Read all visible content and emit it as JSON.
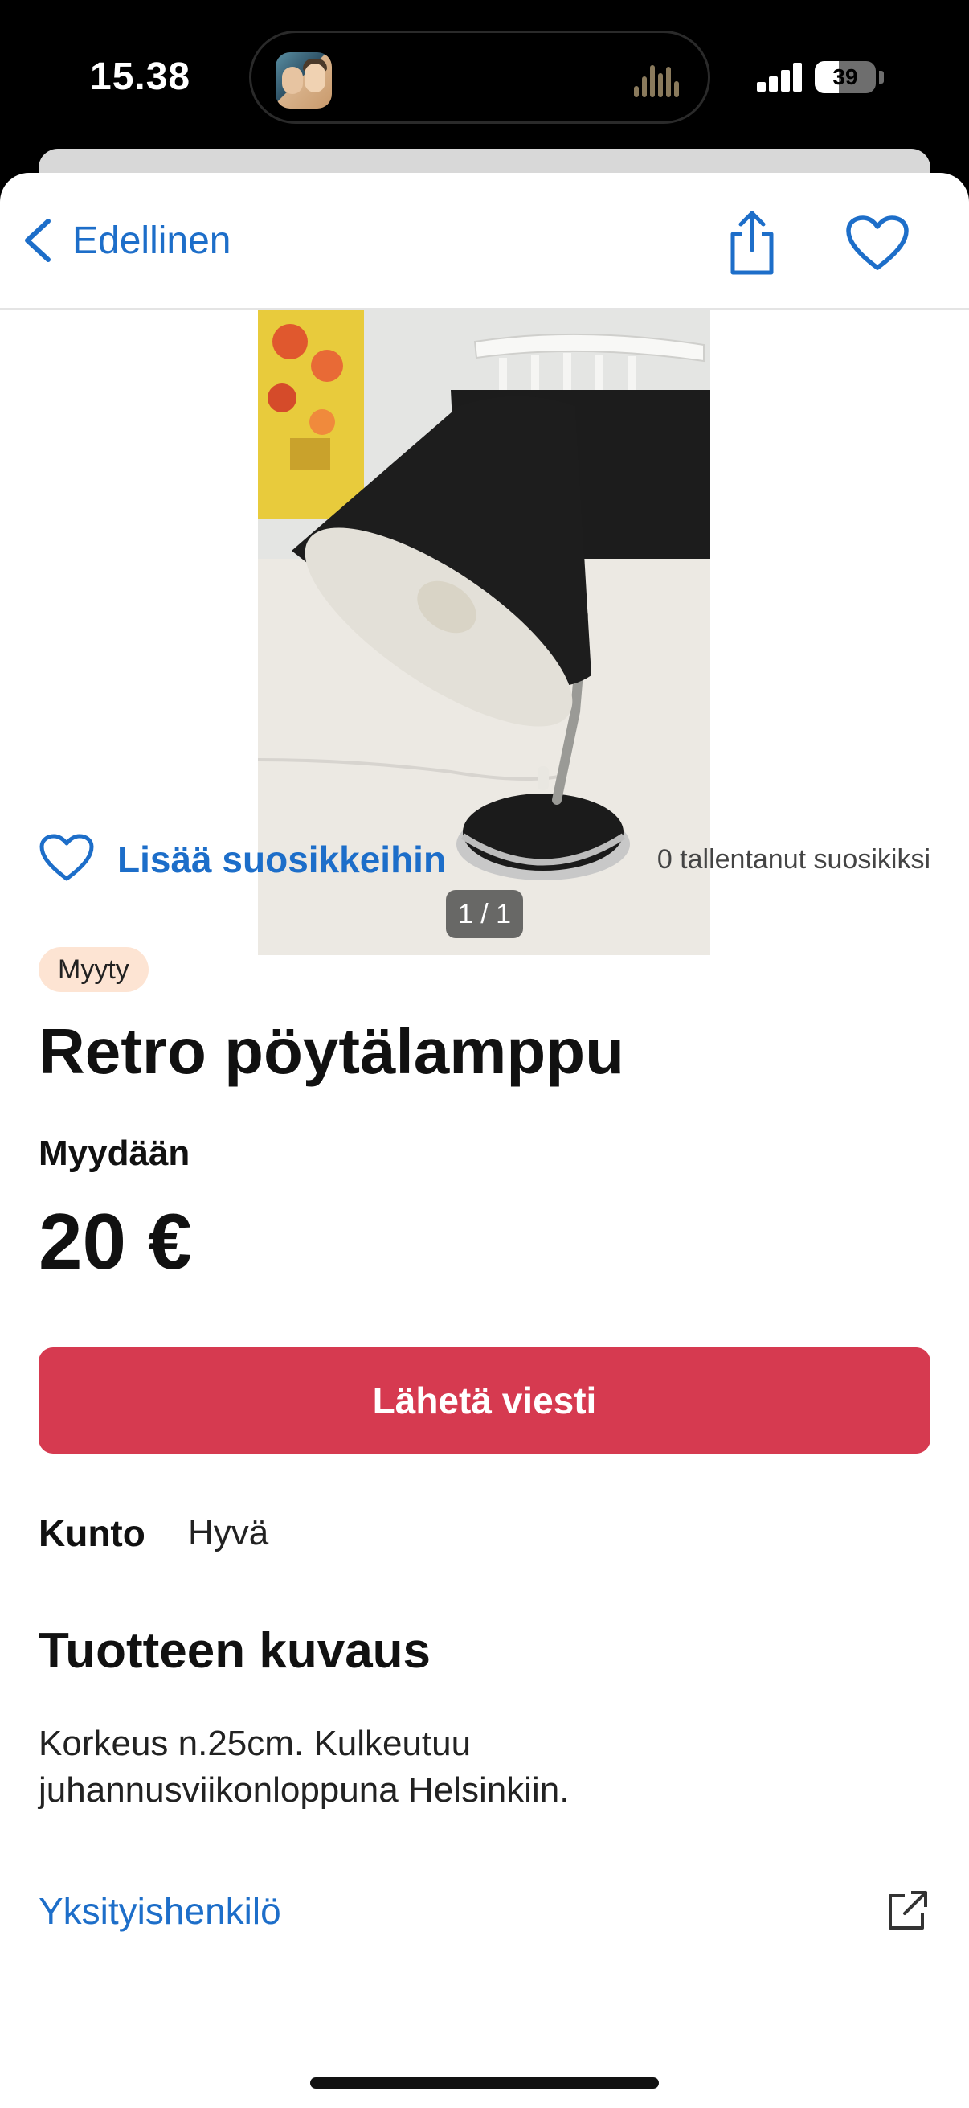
{
  "status_bar": {
    "time": "15.38",
    "battery_level": "39",
    "battery_fraction": 0.39
  },
  "nav": {
    "back_label": "Edellinen",
    "share_icon": "share-icon",
    "favorite_icon": "heart-outline-icon"
  },
  "photo": {
    "counter": "1 / 1"
  },
  "favorites": {
    "add_label": "Lisää suosikkeihin",
    "count_text": "0 tallentanut suosikiksi"
  },
  "listing": {
    "status_badge": "Myyty",
    "title": "Retro pöytälamppu",
    "sale_type": "Myydään",
    "price": "20 €",
    "message_button": "Lähetä viesti",
    "condition_label": "Kunto",
    "condition_value": "Hyvä",
    "description_heading": "Tuotteen kuvaus",
    "description": "Korkeus n.25cm. Kulkeutuu juhannusviikonloppuna Helsinkiin.",
    "seller_type": "Yksityishenkilö"
  },
  "colors": {
    "accent": "#1d6ec9",
    "primary_button": "#d63a50",
    "badge_bg": "#fde4d3"
  }
}
